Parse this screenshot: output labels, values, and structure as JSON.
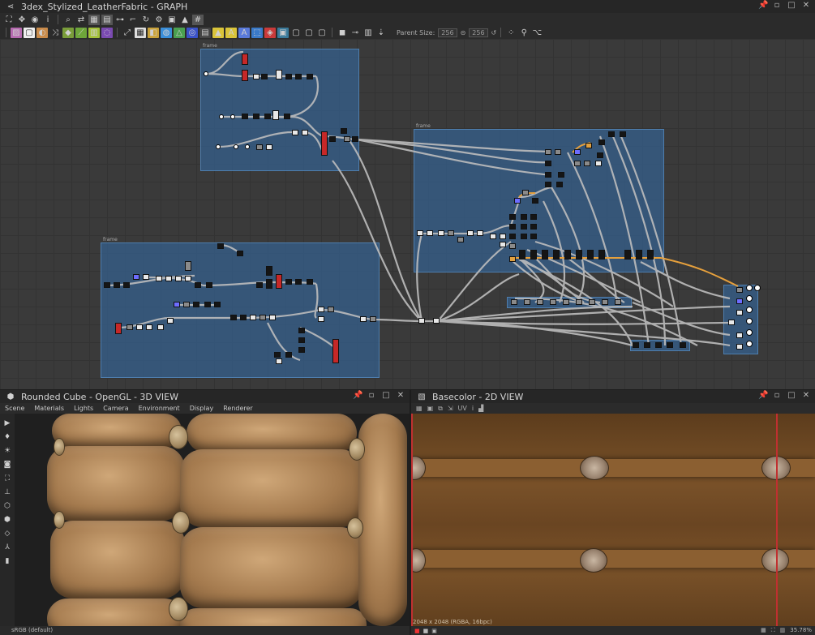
{
  "graph_panel": {
    "title": "3dex_Stylized_LeatherFabric - GRAPH",
    "parent_size_label": "Parent Size:",
    "parent_size_w": "256",
    "parent_size_h": "256"
  },
  "view3d_panel": {
    "title": "Rounded Cube - OpenGL - 3D VIEW",
    "menu": [
      "Scene",
      "Materials",
      "Lights",
      "Camera",
      "Environment",
      "Display",
      "Renderer"
    ],
    "status": "sRGB (default)"
  },
  "view2d_panel": {
    "title": "Basecolor - 2D VIEW",
    "uv_label": "UV",
    "texture_info": "2048 x 2048 (RGBA, 16bpc)",
    "zoom": "35.78%"
  },
  "colors": {
    "frame_blue": "#36608e",
    "wire": "#bdbdbd",
    "wire_orange": "#e6a03c",
    "leather": "#7a5229"
  }
}
